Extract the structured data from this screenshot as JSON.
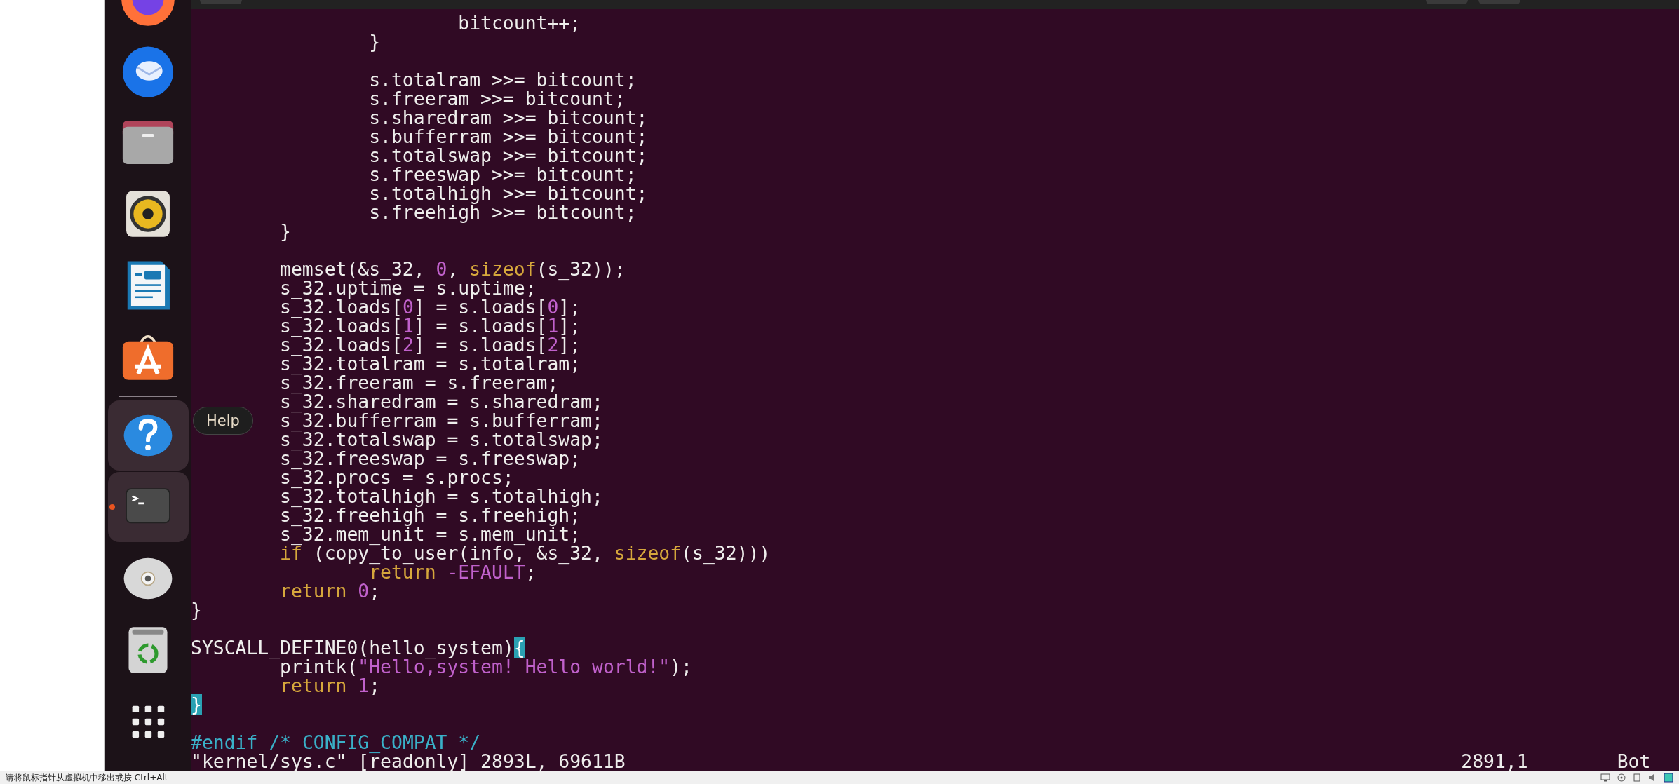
{
  "dock": {
    "items": [
      {
        "kind": "firefox",
        "highlighted": false,
        "running": false
      },
      {
        "kind": "thunderbird",
        "highlighted": false,
        "running": false
      },
      {
        "kind": "files",
        "highlighted": false,
        "running": false
      },
      {
        "kind": "rhythmbox",
        "highlighted": false,
        "running": false
      },
      {
        "kind": "writer",
        "highlighted": false,
        "running": false
      },
      {
        "kind": "appcenter",
        "highlighted": false,
        "running": false
      },
      {
        "kind": "separator"
      },
      {
        "kind": "help",
        "highlighted": true,
        "running": false
      },
      {
        "kind": "terminal",
        "highlighted": true,
        "running": true
      },
      {
        "kind": "dvd",
        "highlighted": false,
        "running": false
      },
      {
        "kind": "trash",
        "highlighted": false,
        "running": false
      },
      {
        "kind": "apps",
        "highlighted": false,
        "running": false
      }
    ],
    "tooltip": {
      "text": "Help"
    }
  },
  "editor": {
    "lines": [
      {
        "kind": "code",
        "segments": [
          {
            "kind": "plain",
            "text": "\t\t\tbitcount++;"
          }
        ]
      },
      {
        "kind": "code",
        "segments": [
          {
            "kind": "plain",
            "text": "\t\t}"
          }
        ]
      },
      {
        "kind": "blank"
      },
      {
        "kind": "code",
        "segments": [
          {
            "kind": "plain",
            "text": "\t\ts.totalram >>= bitcount;"
          }
        ]
      },
      {
        "kind": "code",
        "segments": [
          {
            "kind": "plain",
            "text": "\t\ts.freeram >>= bitcount;"
          }
        ]
      },
      {
        "kind": "code",
        "segments": [
          {
            "kind": "plain",
            "text": "\t\ts.sharedram >>= bitcount;"
          }
        ]
      },
      {
        "kind": "code",
        "segments": [
          {
            "kind": "plain",
            "text": "\t\ts.bufferram >>= bitcount;"
          }
        ]
      },
      {
        "kind": "code",
        "segments": [
          {
            "kind": "plain",
            "text": "\t\ts.totalswap >>= bitcount;"
          }
        ]
      },
      {
        "kind": "code",
        "segments": [
          {
            "kind": "plain",
            "text": "\t\ts.freeswap >>= bitcount;"
          }
        ]
      },
      {
        "kind": "code",
        "segments": [
          {
            "kind": "plain",
            "text": "\t\ts.totalhigh >>= bitcount;"
          }
        ]
      },
      {
        "kind": "code",
        "segments": [
          {
            "kind": "plain",
            "text": "\t\ts.freehigh >>= bitcount;"
          }
        ]
      },
      {
        "kind": "code",
        "segments": [
          {
            "kind": "plain",
            "text": "\t}"
          }
        ]
      },
      {
        "kind": "blank"
      },
      {
        "kind": "code",
        "segments": [
          {
            "kind": "plain",
            "text": "\tmemset(&s_32, "
          },
          {
            "kind": "number",
            "text": "0"
          },
          {
            "kind": "plain",
            "text": ", "
          },
          {
            "kind": "keyword",
            "text": "sizeof"
          },
          {
            "kind": "plain",
            "text": "(s_32));"
          }
        ]
      },
      {
        "kind": "code",
        "segments": [
          {
            "kind": "plain",
            "text": "\ts_32.uptime = s.uptime;"
          }
        ]
      },
      {
        "kind": "code",
        "segments": [
          {
            "kind": "plain",
            "text": "\ts_32.loads["
          },
          {
            "kind": "number",
            "text": "0"
          },
          {
            "kind": "plain",
            "text": "] = s.loads["
          },
          {
            "kind": "number",
            "text": "0"
          },
          {
            "kind": "plain",
            "text": "];"
          }
        ]
      },
      {
        "kind": "code",
        "segments": [
          {
            "kind": "plain",
            "text": "\ts_32.loads["
          },
          {
            "kind": "number",
            "text": "1"
          },
          {
            "kind": "plain",
            "text": "] = s.loads["
          },
          {
            "kind": "number",
            "text": "1"
          },
          {
            "kind": "plain",
            "text": "];"
          }
        ]
      },
      {
        "kind": "code",
        "segments": [
          {
            "kind": "plain",
            "text": "\ts_32.loads["
          },
          {
            "kind": "number",
            "text": "2"
          },
          {
            "kind": "plain",
            "text": "] = s.loads["
          },
          {
            "kind": "number",
            "text": "2"
          },
          {
            "kind": "plain",
            "text": "];"
          }
        ]
      },
      {
        "kind": "code",
        "segments": [
          {
            "kind": "plain",
            "text": "\ts_32.totalram = s.totalram;"
          }
        ]
      },
      {
        "kind": "code",
        "segments": [
          {
            "kind": "plain",
            "text": "\ts_32.freeram = s.freeram;"
          }
        ]
      },
      {
        "kind": "code",
        "segments": [
          {
            "kind": "plain",
            "text": "\ts_32.sharedram = s.sharedram;"
          }
        ]
      },
      {
        "kind": "code",
        "segments": [
          {
            "kind": "plain",
            "text": "\ts_32.bufferram = s.bufferram;"
          }
        ]
      },
      {
        "kind": "code",
        "segments": [
          {
            "kind": "plain",
            "text": "\ts_32.totalswap = s.totalswap;"
          }
        ]
      },
      {
        "kind": "code",
        "segments": [
          {
            "kind": "plain",
            "text": "\ts_32.freeswap = s.freeswap;"
          }
        ]
      },
      {
        "kind": "code",
        "segments": [
          {
            "kind": "plain",
            "text": "\ts_32.procs = s.procs;"
          }
        ]
      },
      {
        "kind": "code",
        "segments": [
          {
            "kind": "plain",
            "text": "\ts_32.totalhigh = s.totalhigh;"
          }
        ]
      },
      {
        "kind": "code",
        "segments": [
          {
            "kind": "plain",
            "text": "\ts_32.freehigh = s.freehigh;"
          }
        ]
      },
      {
        "kind": "code",
        "segments": [
          {
            "kind": "plain",
            "text": "\ts_32.mem_unit = s.mem_unit;"
          }
        ]
      },
      {
        "kind": "code",
        "segments": [
          {
            "kind": "keyword",
            "text": "\tif"
          },
          {
            "kind": "plain",
            "text": " (copy_to_user(info, &s_32, "
          },
          {
            "kind": "keyword",
            "text": "sizeof"
          },
          {
            "kind": "plain",
            "text": "(s_32)))"
          }
        ]
      },
      {
        "kind": "code",
        "segments": [
          {
            "kind": "keyword",
            "text": "\t\treturn"
          },
          {
            "kind": "constant",
            "text": " -EFAULT"
          },
          {
            "kind": "plain",
            "text": ";"
          }
        ]
      },
      {
        "kind": "code",
        "segments": [
          {
            "kind": "keyword",
            "text": "\treturn"
          },
          {
            "kind": "number",
            "text": " 0"
          },
          {
            "kind": "plain",
            "text": ";"
          }
        ]
      },
      {
        "kind": "code",
        "segments": [
          {
            "kind": "plain",
            "text": "}"
          }
        ]
      },
      {
        "kind": "blank"
      },
      {
        "kind": "code",
        "segments": [
          {
            "kind": "plain",
            "text": "SYSCALL_DEFINE0(hello_system)"
          },
          {
            "kind": "match",
            "text": "{"
          }
        ]
      },
      {
        "kind": "code",
        "segments": [
          {
            "kind": "plain",
            "text": "\tprintk("
          },
          {
            "kind": "string",
            "text": "\"Hello,system! Hello world!\""
          },
          {
            "kind": "plain",
            "text": ");"
          }
        ]
      },
      {
        "kind": "code",
        "segments": [
          {
            "kind": "keyword",
            "text": "\treturn"
          },
          {
            "kind": "number",
            "text": " 1"
          },
          {
            "kind": "plain",
            "text": ";"
          }
        ]
      },
      {
        "kind": "code",
        "segments": [
          {
            "kind": "match",
            "text": "}"
          }
        ]
      },
      {
        "kind": "blank"
      },
      {
        "kind": "code",
        "segments": [
          {
            "kind": "preproc",
            "text": "#endif"
          },
          {
            "kind": "comment",
            "text": " /* CONFIG_COMPAT */"
          }
        ]
      }
    ],
    "status": {
      "file_info": "\"kernel/sys.c\" [readonly] 2893L, 69611B",
      "cursor": "2891,1",
      "scroll": "Bot"
    }
  },
  "host_status": {
    "message": "请将鼠标指针从虚拟机中移出或按 Ctrl+Alt"
  }
}
